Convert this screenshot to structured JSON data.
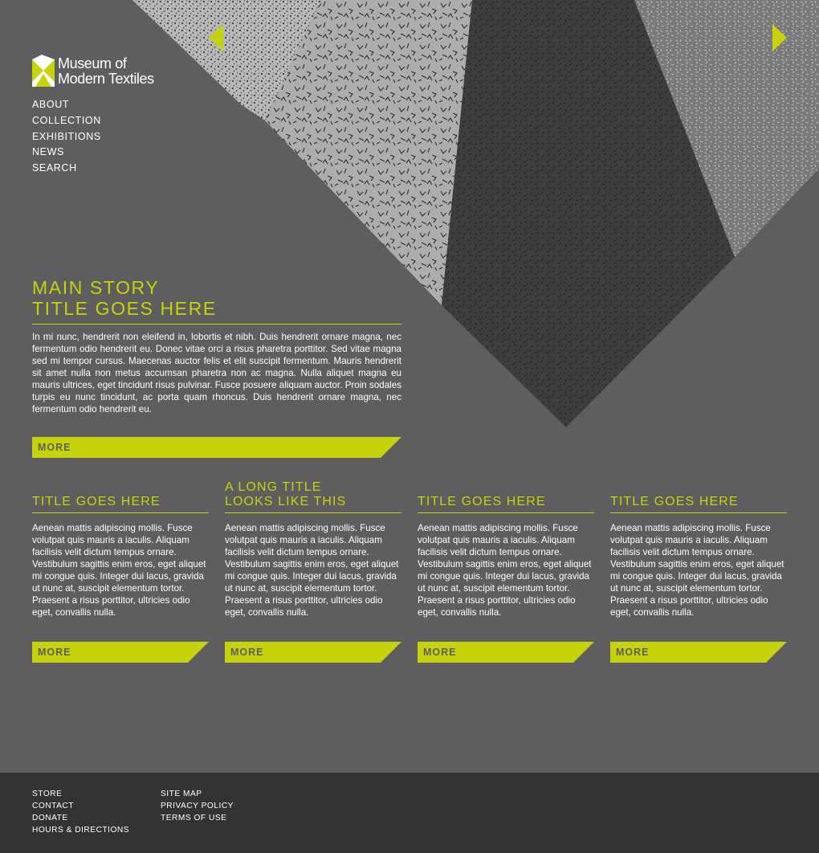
{
  "brand": {
    "name_line1": "Museum of",
    "name_line2": "Modern Textiles",
    "accent_color": "#c6d20c",
    "background_color": "#5e5e5e",
    "footer_color": "#333333"
  },
  "nav": {
    "items": [
      "ABOUT",
      "COLLECTION",
      "EXHIBITIONS",
      "NEWS",
      "SEARCH"
    ]
  },
  "carousel": {
    "prev_icon": "triangle-left-icon",
    "next_icon": "triangle-right-icon"
  },
  "main_story": {
    "title_line1": "MAIN STORY",
    "title_line2": "TITLE GOES HERE",
    "body": "In mi nunc, hendrerit non eleifend in, lobortis et nibh. Duis hendrerit ornare magna, nec fermentum odio hendrerit eu. Donec vitae orci a risus pharetra porttitor. Sed vitae magna sed mi tempor cursus. Maecenas auctor felis et elit suscipit fermentum. Mauris hendrerit sit amet nulla non metus accumsan pharetra non ac magna. Nulla aliquet magna eu mauris ultrices, eget tincidunt risus pulvinar. Fusce posuere aliquam auctor. Proin sodales turpis eu nunc tincidunt, ac porta quam rhoncus. Duis hendrerit ornare magna, nec fermentum odio hendrerit eu.",
    "more_label": "MORE"
  },
  "stories": [
    {
      "title_line1": "TITLE GOES HERE",
      "title_line2": "",
      "body": "Aenean mattis adipiscing mollis. Fusce volutpat quis mauris a iaculis. Aliquam facilisis velit dictum tempus ornare. Vestibulum sagittis enim eros, eget aliquet mi congue quis. Integer dui lacus, gravida ut nunc at, suscipit elementum tortor. Praesent a risus porttitor, ultricies odio eget, convallis nulla.",
      "more_label": "MORE"
    },
    {
      "title_line1": "A LONG TITLE",
      "title_line2": "LOOKS LIKE THIS",
      "body": "Aenean mattis adipiscing mollis. Fusce volutpat quis mauris a iaculis. Aliquam facilisis velit dictum tempus ornare. Vestibulum sagittis enim eros, eget aliquet mi congue quis. Integer dui lacus, gravida ut nunc at, suscipit elementum tortor. Praesent a risus porttitor, ultricies odio eget, convallis nulla.",
      "more_label": "MORE"
    },
    {
      "title_line1": "TITLE GOES HERE",
      "title_line2": "",
      "body": "Aenean mattis adipiscing mollis. Fusce volutpat quis mauris a iaculis. Aliquam facilisis velit dictum tempus ornare. Vestibulum sagittis enim eros, eget aliquet mi congue quis. Integer dui lacus, gravida ut nunc at, suscipit elementum tortor. Praesent a risus porttitor, ultricies odio eget, convallis nulla.",
      "more_label": "MORE"
    },
    {
      "title_line1": "TITLE GOES HERE",
      "title_line2": "",
      "body": "Aenean mattis adipiscing mollis. Fusce volutpat quis mauris a iaculis. Aliquam facilisis velit dictum tempus ornare. Vestibulum sagittis enim eros, eget aliquet mi congue quis. Integer dui lacus, gravida ut nunc at, suscipit elementum tortor. Praesent a risus porttitor, ultricies odio eget, convallis nulla.",
      "more_label": "MORE"
    }
  ],
  "footer": {
    "col1": [
      "STORE",
      "CONTACT",
      "DONATE",
      "HOURS & DIRECTIONS"
    ],
    "col2": [
      "SITE MAP",
      "PRIVACY POLICY",
      "TERMS OF USE"
    ]
  }
}
